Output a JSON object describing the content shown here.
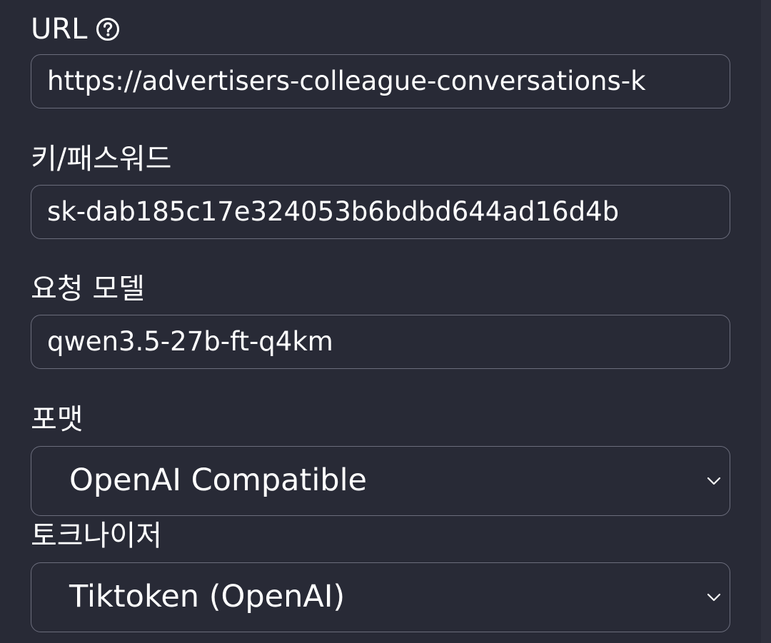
{
  "url": {
    "label": "URL",
    "help_icon": "help-circle-icon",
    "value": "https://advertisers-colleague-conversations-k"
  },
  "key": {
    "label": "키/패스워드",
    "value": "sk-dab185c17e324053b6bdbd644ad16d4b"
  },
  "model": {
    "label": "요청 모델",
    "value": "qwen3.5-27b-ft-q4km"
  },
  "format": {
    "label": "포맷",
    "selected": "OpenAI Compatible",
    "chevron_icon": "chevron-down-icon"
  },
  "tokenizer": {
    "label": "토크나이저",
    "selected": "Tiktoken (OpenAI)",
    "chevron_icon": "chevron-down-icon"
  },
  "colors": {
    "background": "#282a36",
    "border": "#6b6d7c",
    "text": "#ffffff"
  }
}
